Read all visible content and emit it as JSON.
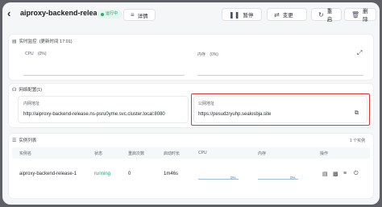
{
  "header": {
    "title": "aiproxy-backend-release",
    "status": "运行中",
    "details_button": "详情",
    "buttons": [
      {
        "label": "暂停",
        "icon": "pause-icon"
      },
      {
        "label": "变更",
        "icon": "swap-icon"
      },
      {
        "label": "重启",
        "icon": "restart-icon"
      },
      {
        "label": "删除",
        "icon": "trash-icon"
      }
    ]
  },
  "monitor": {
    "title": "实时监控",
    "update_time": "(更新时间 17:01)",
    "cpu_label": "CPU",
    "cpu_value": "(0%)",
    "memory_label": "内存",
    "memory_value": "(0%)"
  },
  "network": {
    "title": "网络配置(1)",
    "internal_label": "内网地址",
    "internal_value": "http://aiproxy-backend-release.ns-psru0yme.svc.cluster.local:8080",
    "public_label": "公网地址",
    "public_value": "https://pesudzryuhp.sealosbja.site"
  },
  "instances": {
    "title": "实例列表",
    "count": "1 个实例",
    "columns": [
      "实例名",
      "状态",
      "重启次数",
      "启动时长",
      "CPU",
      "内存",
      "操作"
    ],
    "rows": [
      {
        "name": "aiproxy-backend-release-1",
        "status": "running",
        "restarts": "0",
        "uptime": "1m46s",
        "cpu": "0%",
        "memory": "0%"
      }
    ]
  },
  "colors": {
    "accent": "#1b9c6a",
    "highlight": "#d53b36"
  }
}
